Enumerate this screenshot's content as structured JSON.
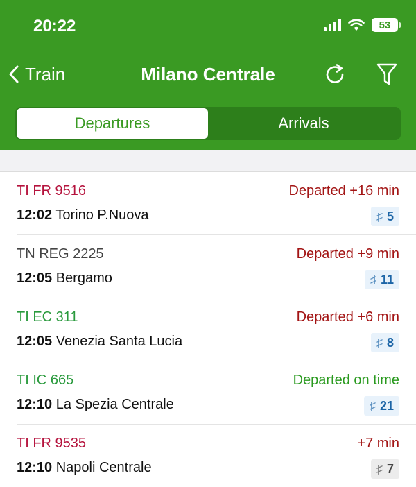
{
  "status_bar": {
    "time": "20:22",
    "battery": "53"
  },
  "nav": {
    "back_label": "Train",
    "title": "Milano Centrale"
  },
  "tabs": [
    {
      "label": "Departures",
      "active": true
    },
    {
      "label": "Arrivals",
      "active": false
    }
  ],
  "colors": {
    "header_green": "#3a9a23",
    "segment_bg": "#2d7f1b",
    "operator_crimson": "#b5133d",
    "operator_gray": "#444444",
    "operator_green": "#2a9a3d",
    "status_red": "#a31515",
    "status_green": "#2a9a1f",
    "platform_blue_bg": "#e8f2fb",
    "platform_blue_text": "#1b64a6",
    "platform_gray_bg": "#ececec",
    "platform_gray_text": "#444444"
  },
  "departures": [
    {
      "train": "TI FR 9516",
      "train_color": "#b5133d",
      "time": "12:02",
      "destination": "Torino P.Nuova",
      "status": "Departed +16 min",
      "status_color": "#a31515",
      "platform": "5",
      "platform_style": "blue"
    },
    {
      "train": "TN REG 2225",
      "train_color": "#444444",
      "time": "12:05",
      "destination": "Bergamo",
      "status": "Departed +9 min",
      "status_color": "#a31515",
      "platform": "11",
      "platform_style": "blue"
    },
    {
      "train": "TI EC 311",
      "train_color": "#2a9a3d",
      "time": "12:05",
      "destination": "Venezia Santa Lucia",
      "status": "Departed +6 min",
      "status_color": "#a31515",
      "platform": "8",
      "platform_style": "blue"
    },
    {
      "train": "TI IC 665",
      "train_color": "#2a9a3d",
      "time": "12:10",
      "destination": "La Spezia Centrale",
      "status": "Departed on time",
      "status_color": "#2a9a1f",
      "platform": "21",
      "platform_style": "blue"
    },
    {
      "train": "TI FR 9535",
      "train_color": "#b5133d",
      "time": "12:10",
      "destination": "Napoli Centrale",
      "status": "+7 min",
      "status_color": "#a31515",
      "platform": "7",
      "platform_style": "gray"
    }
  ]
}
